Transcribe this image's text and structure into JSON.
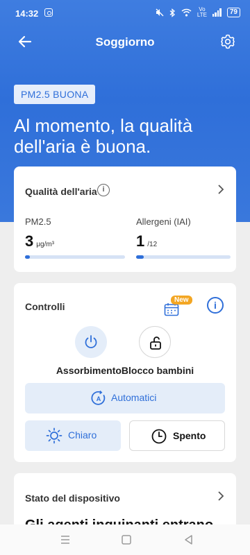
{
  "status_bar": {
    "time": "14:32",
    "battery": "79",
    "network": "Vo LTE"
  },
  "header": {
    "title": "Soggiorno"
  },
  "hero": {
    "badge": "PM2.5 BUONA",
    "headline": "Al momento, la qualità dell'aria è buona."
  },
  "air_quality": {
    "title": "Qualità dell'aria",
    "info_glyph": "i",
    "pm": {
      "label": "PM2.5",
      "value": "3",
      "unit": "μg/m³",
      "level": 0.05
    },
    "allergens": {
      "label": "Allergeni (IAI)",
      "value": "1",
      "unit": "/12",
      "level": 0.08
    }
  },
  "controls": {
    "title": "Controlli",
    "new_badge": "New",
    "info_glyph": "i",
    "circle_labels": "AssorbimentoBlocco bambini",
    "auto_label": "Automatici",
    "light_label": "Chiaro",
    "timer_label": "Spento"
  },
  "device_state": {
    "title": "Stato del dispositivo",
    "body": "Gli agenti inquinanti entrano"
  },
  "colors": {
    "accent": "#2f6fd9",
    "accent_soft": "#e4edf9",
    "new_badge": "#f3a623"
  }
}
